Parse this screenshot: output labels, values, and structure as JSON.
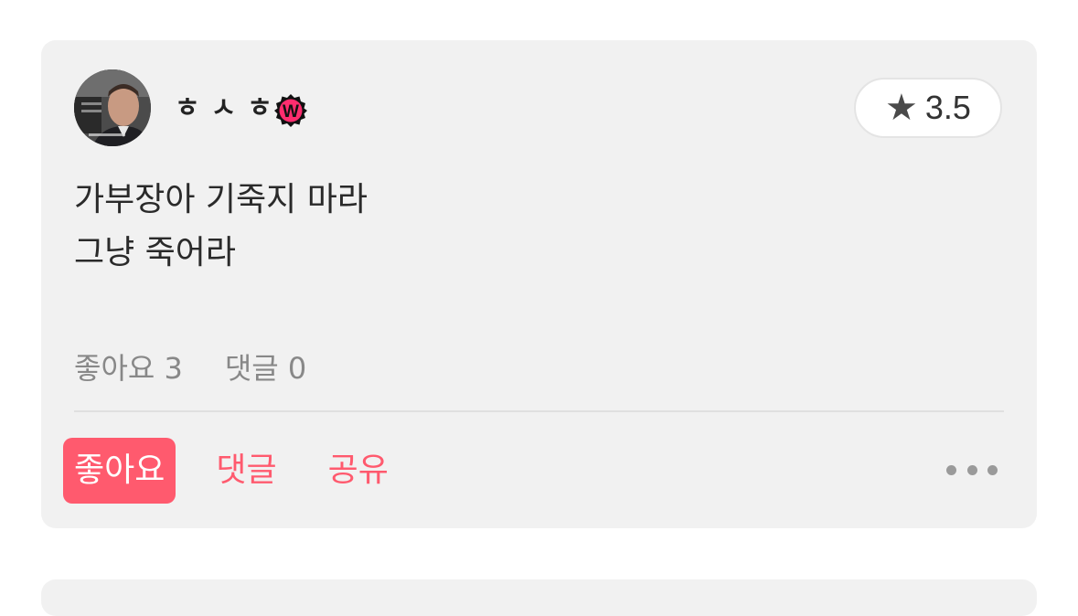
{
  "post": {
    "user": {
      "name": "ㅎㅅㅎ",
      "badge": "W"
    },
    "rating": {
      "icon": "star-icon",
      "value": "3.5"
    },
    "body": {
      "line1": "가부장아 기죽지 마라",
      "line2": "그냥 죽어라"
    },
    "stats": {
      "likes": "좋아요 3",
      "comments": "댓글 0"
    },
    "actions": {
      "like_label": "좋아요",
      "comment_label": "댓글",
      "share_label": "공유",
      "more_icon": "more-horizontal-icon"
    }
  },
  "colors": {
    "accent": "#ff5a6e",
    "card_bg": "#f1f1f1",
    "badge": "#ff2d6f"
  }
}
